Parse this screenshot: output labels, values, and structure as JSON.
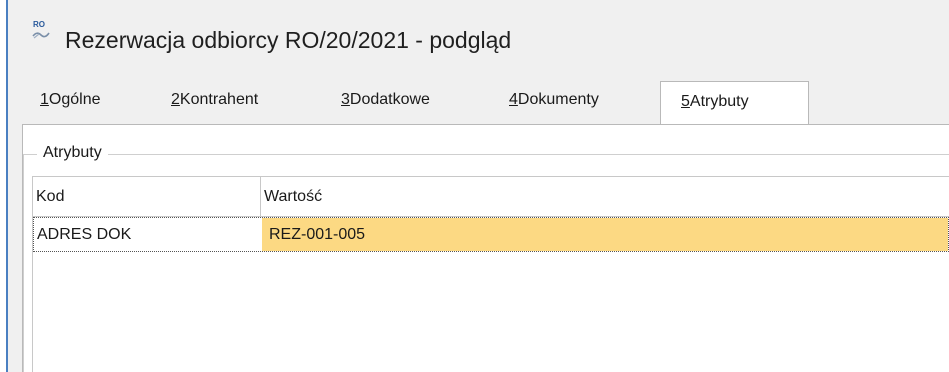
{
  "window": {
    "badge": "RO",
    "title": "Rezerwacja odbiorcy RO/20/2021 - podgląd"
  },
  "tabs": [
    {
      "key": "1",
      "label": "Ogólne"
    },
    {
      "key": "2",
      "label": "Kontrahent"
    },
    {
      "key": "3",
      "label": "Dodatkowe"
    },
    {
      "key": "4",
      "label": "Dokumenty"
    },
    {
      "key": "5",
      "label": "Atrybuty",
      "active": true
    }
  ],
  "group": {
    "label": "Atrybuty"
  },
  "grid": {
    "columns": [
      "Kod",
      "Wartość"
    ],
    "rows": [
      {
        "kod": "ADRES DOK",
        "wartosc": "REZ-001-005"
      }
    ],
    "selected_color": "#fcd983"
  }
}
